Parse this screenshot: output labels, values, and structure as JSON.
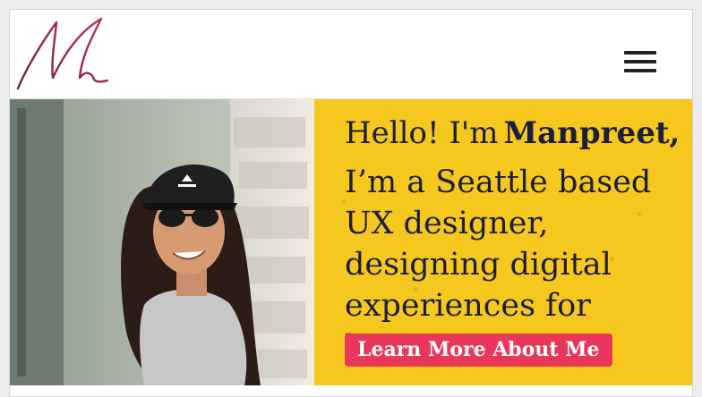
{
  "header": {
    "logo_letter": "M",
    "menu_icon": "hamburger-menu-icon"
  },
  "hero": {
    "greeting": "Hello! I'm",
    "name": "Manpreet,",
    "tagline": "I’m a Seattle based UX designer, designing digital experiences for humans.",
    "cta_label": "Learn More About Me",
    "photo_alt": "Manpreet wearing a black cap and sunglasses"
  },
  "colors": {
    "panel_bg": "#f6c81e",
    "heading_text": "#1c1e3f",
    "cta_bg": "#e8375a",
    "logo_stroke": "#9b2d4c"
  }
}
